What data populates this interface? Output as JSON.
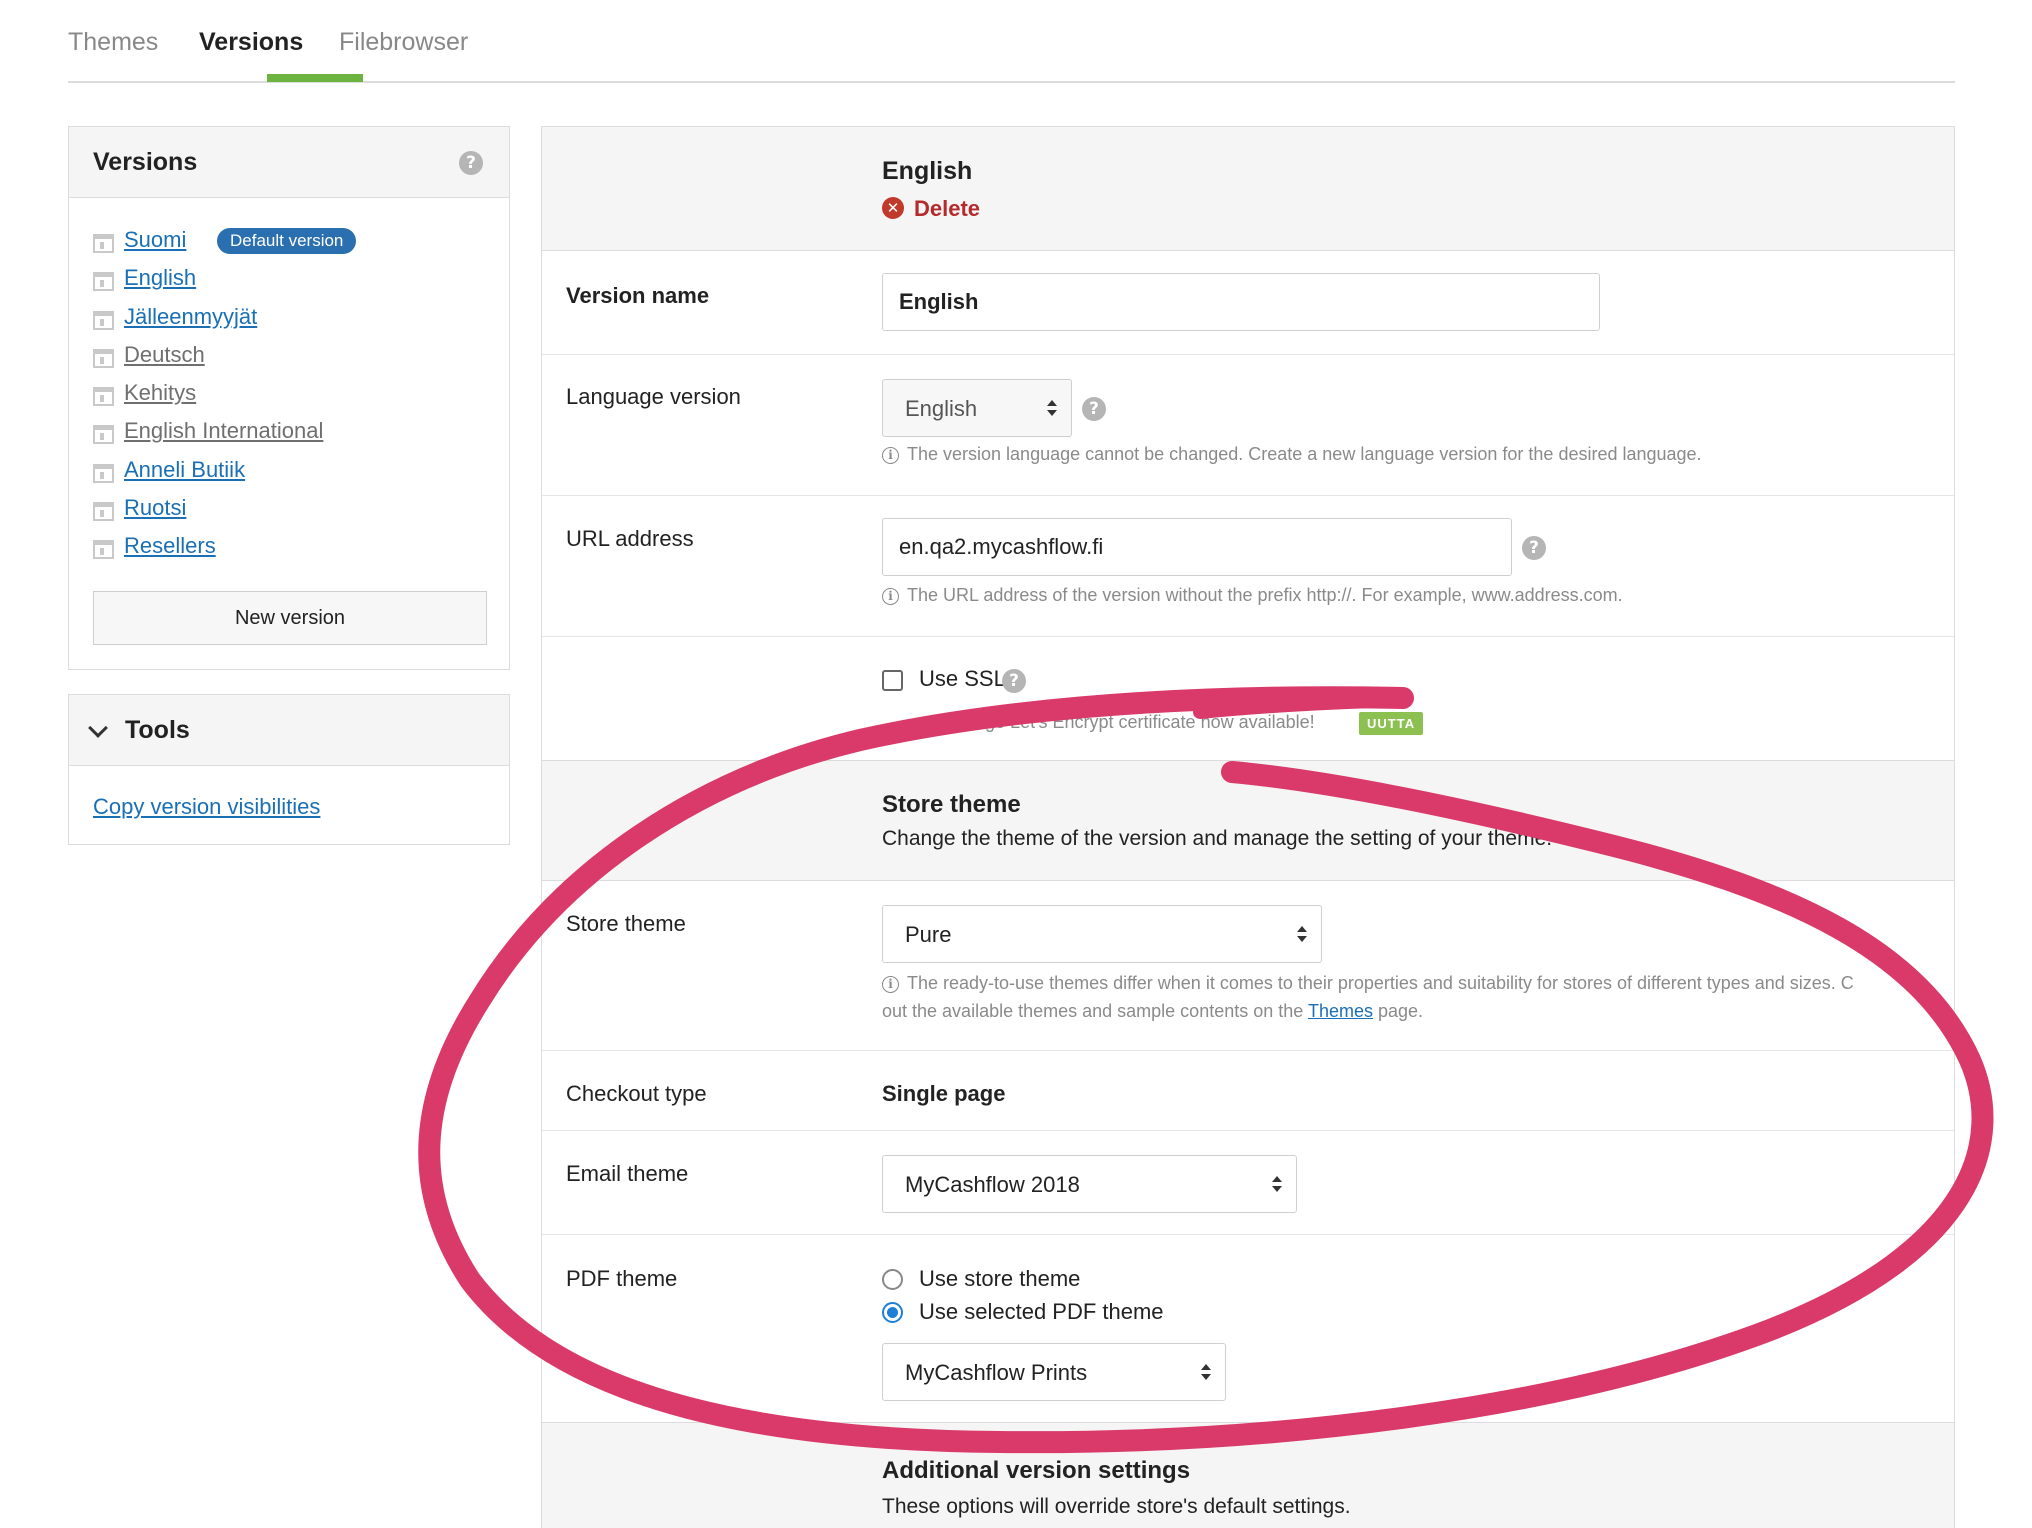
{
  "tabs": [
    "Themes",
    "Versions",
    "Filebrowser"
  ],
  "sidebar": {
    "title": "Versions",
    "default_badge": "Default version",
    "versions": [
      "Suomi",
      "English",
      "Jälleenmyyjät",
      "Deutsch",
      "Kehitys",
      "English International",
      "Anneli Butiik",
      "Ruotsi",
      "Resellers"
    ],
    "new_version_button": "New version"
  },
  "tools": {
    "title": "Tools",
    "copy_link": "Copy version visibilities"
  },
  "main": {
    "header_title": "English",
    "delete_label": "Delete",
    "version_name": {
      "label": "Version name",
      "value": "English"
    },
    "language_version": {
      "label": "Language version",
      "value": "English",
      "hint": "The version language cannot be changed. Create a new language version for the desired language."
    },
    "url_address": {
      "label": "URL address",
      "value": "en.qa2.mycashflow.fi",
      "hint": "The URL address of the version without the prefix http://. For example, www.address.com."
    },
    "ssl": {
      "label": "Use SSL",
      "hint": "… of charge Let's Encrypt certificate now available!",
      "badge": "UUTTA"
    },
    "store_theme_section": {
      "title": "Store theme",
      "subtitle": "Change the theme of the version and manage the setting of your theme."
    },
    "store_theme": {
      "label": "Store theme",
      "value": "Pure",
      "hint_line1": "The ready-to-use themes differ when it comes to their properties and suitability for stores of different types and sizes. C",
      "hint_line2_prefix": "out the available themes and sample contents on the",
      "hint_link": "Themes",
      "hint_line2_suffix": "page."
    },
    "checkout_type": {
      "label": "Checkout type",
      "value": "Single page"
    },
    "email_theme": {
      "label": "Email theme",
      "value": "MyCashflow 2018"
    },
    "pdf_theme": {
      "label": "PDF theme",
      "option_store": "Use store theme",
      "option_selected": "Use selected PDF theme",
      "value": "MyCashflow Prints"
    },
    "additional_section": {
      "title": "Additional version settings",
      "subtitle": "These options will override store's default settings."
    }
  },
  "colors": {
    "accent_green": "#6db33f",
    "link_blue": "#1a6fb5",
    "badge_blue": "#2a6fb0",
    "delete_red": "#b52a2a",
    "annotation_pink": "#d93a6a"
  }
}
